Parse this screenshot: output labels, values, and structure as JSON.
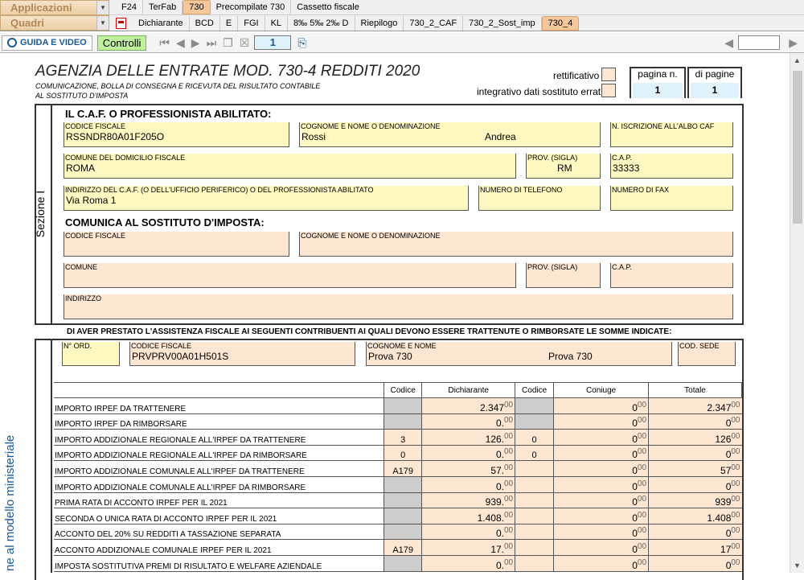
{
  "toolbar": {
    "menu_apps": "Applicazioni",
    "menu_quadri": "Quadri",
    "tabs1": [
      "F24",
      "TerFab",
      "730",
      "Precompilate 730",
      "Cassetto fiscale"
    ],
    "tabs2": [
      "Dichiarante",
      "BCD",
      "E",
      "FGI",
      "KL",
      "8‰ 5‰ 2‰ D",
      "Riepilogo",
      "730_2_CAF",
      "730_2_Sost_imp",
      "730_4"
    ],
    "guida": "GUIDA E VIDEO",
    "controlli": "Controlli",
    "page": "1"
  },
  "header": {
    "title": "AGENZIA DELLE ENTRATE MOD. 730-4 REDDITI 2020",
    "sub1": "COMUNICAZIONE, BOLLA DI CONSEGNA E RICEVUTA DEL RISULTATO CONTABILE",
    "sub2": "AL SOSTITUTO D'IMPOSTA",
    "rettificativo": "rettificativo",
    "integrativo": "integrativo dati sostituto errati",
    "pagina_label": "pagina n.",
    "pagine_label": "di pagine",
    "pagina": "1",
    "pagine": "1"
  },
  "sezione": "Sezione I",
  "side_text": "ne al modello ministeriale",
  "caf": {
    "heading": "IL C.A.F. O PROFESSIONISTA ABILITATO:",
    "cf_label": "CODICE FISCALE",
    "cf": "RSSNDR80A01F205O",
    "nome_label": "COGNOME E NOME O DENOMINAZIONE",
    "cognome": "Rossi",
    "nome": "Andrea",
    "albo_label": "N. ISCRIZIONE ALL'ALBO CAF",
    "comune_label": "COMUNE DEL DOMICILIO FISCALE",
    "comune": "ROMA",
    "prov_label": "PROV. (SIGLA)",
    "prov": "RM",
    "cap_label": "C.A.P.",
    "cap": "33333",
    "ind_label": "INDIRIZZO DEL C.A.F. (O DELL'UFFICIO PERIFERICO) O DEL PROFESSIONISTA ABILITATO",
    "ind": "Via Roma 1",
    "tel_label": "NUMERO DI TELEFONO",
    "fax_label": "NUMERO DI FAX"
  },
  "sost": {
    "heading": "COMUNICA AL SOSTITUTO D'IMPOSTA:",
    "cf_label": "CODICE FISCALE",
    "nome_label": "COGNOME E NOME O DENOMINAZIONE",
    "comune_label": "COMUNE",
    "prov_label": "PROV. (SIGLA)",
    "cap_label": "C.A.P.",
    "ind_label": "INDIRIZZO"
  },
  "assist": "DI AVER PRESTATO L'ASSISTENZA FISCALE AI SEGUENTI CONTRIBUENTI AI QUALI DEVONO ESSERE TRATTENUTE O RIMBORSATE LE SOMME INDICATE:",
  "contrib": {
    "nord_label": "N° ORD.",
    "cf_label": "CODICE FISCALE",
    "cf": "PRVPRV00A01H501S",
    "nome_label": "COGNOME E NOME",
    "cognome": "Prova 730",
    "nome": "Prova 730",
    "sede_label": "COD. SEDE"
  },
  "table": {
    "headers": [
      "Codice",
      "Dichiarante",
      "Codice",
      "Coniuge",
      "Totale"
    ],
    "rows": [
      {
        "d": "IMPORTO IRPEF DA TRATTENERE",
        "c1": "",
        "v1": "2.347",
        "c2": "",
        "v2": "0",
        "t": "2.347"
      },
      {
        "d": "IMPORTO IRPEF DA RIMBORSARE",
        "c1": "",
        "v1": "0.",
        "c2": "",
        "v2": "0",
        "t": "0"
      },
      {
        "d": "IMPORTO ADDIZIONALE REGIONALE ALL'IRPEF DA TRATTENERE",
        "c1": "3",
        "v1": "126.",
        "c2": "0",
        "v2": "0",
        "t": "126"
      },
      {
        "d": "IMPORTO ADDIZIONALE REGIONALE ALL'IRPEF DA RIMBORSARE",
        "c1": "0",
        "v1": "0.",
        "c2": "0",
        "v2": "0",
        "t": "0"
      },
      {
        "d": "IMPORTO ADDIZIONALE COMUNALE ALL'IRPEF DA TRATTENERE",
        "c1": "A179",
        "v1": "57.",
        "c2": "",
        "v2": "0",
        "t": "57"
      },
      {
        "d": "IMPORTO ADDIZIONALE COMUNALE ALL'IRPEF DA RIMBORSARE",
        "c1": "",
        "v1": "0.",
        "c2": "",
        "v2": "0",
        "t": "0"
      },
      {
        "d": "PRIMA RATA DI ACCONTO IRPEF PER IL 2021",
        "c1": "",
        "v1": "939.",
        "c2": "",
        "v2": "0",
        "t": "939"
      },
      {
        "d": "SECONDA O UNICA RATA DI ACCONTO IRPEF PER IL 2021",
        "c1": "",
        "v1": "1.408.",
        "c2": "",
        "v2": "0",
        "t": "1.408"
      },
      {
        "d": "ACCONTO DEL 20% SU REDDITI A TASSAZIONE SEPARATA",
        "c1": "",
        "v1": "0.",
        "c2": "",
        "v2": "0",
        "t": "0"
      },
      {
        "d": "ACCONTO ADDIZIONALE COMUNALE IRPEF PER IL 2021",
        "c1": "A179",
        "v1": "17.",
        "c2": "",
        "v2": "0",
        "t": "17"
      },
      {
        "d": "IMPOSTA SOSTITUTIVA PREMI DI RISULTATO E WELFARE AZIENDALE",
        "c1": "",
        "v1": "0.",
        "c2": "",
        "v2": "0",
        "t": "0"
      }
    ]
  },
  "decimals": "00"
}
